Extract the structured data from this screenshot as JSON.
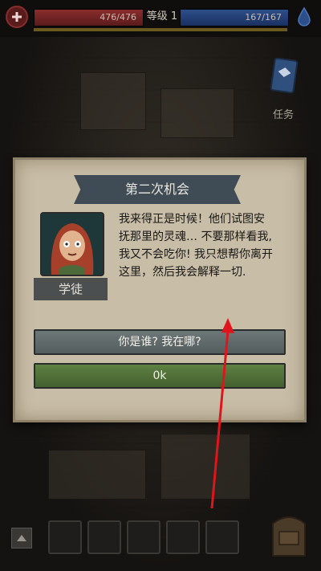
{
  "hud": {
    "hp_text": "476/476",
    "level_text": "等级 1",
    "mp_text": "167/167"
  },
  "quest": {
    "label": "任务"
  },
  "dialog": {
    "title": "第二次机会",
    "speaker": "学徒",
    "lines": [
      "我来得正是时候！他们试图安",
      "抚那里的灵魂… 不要那样看我,",
      "我又不会吃你! 我只想帮你离开",
      "这里，然后我会解释一切."
    ],
    "option_question": "你是谁? 我在哪?",
    "option_ok": "0k"
  },
  "colors": {
    "hp": "#8a2c2c",
    "mp": "#2c4f8a",
    "ok_button": "#5e8143",
    "arrow": "#e0151b"
  }
}
